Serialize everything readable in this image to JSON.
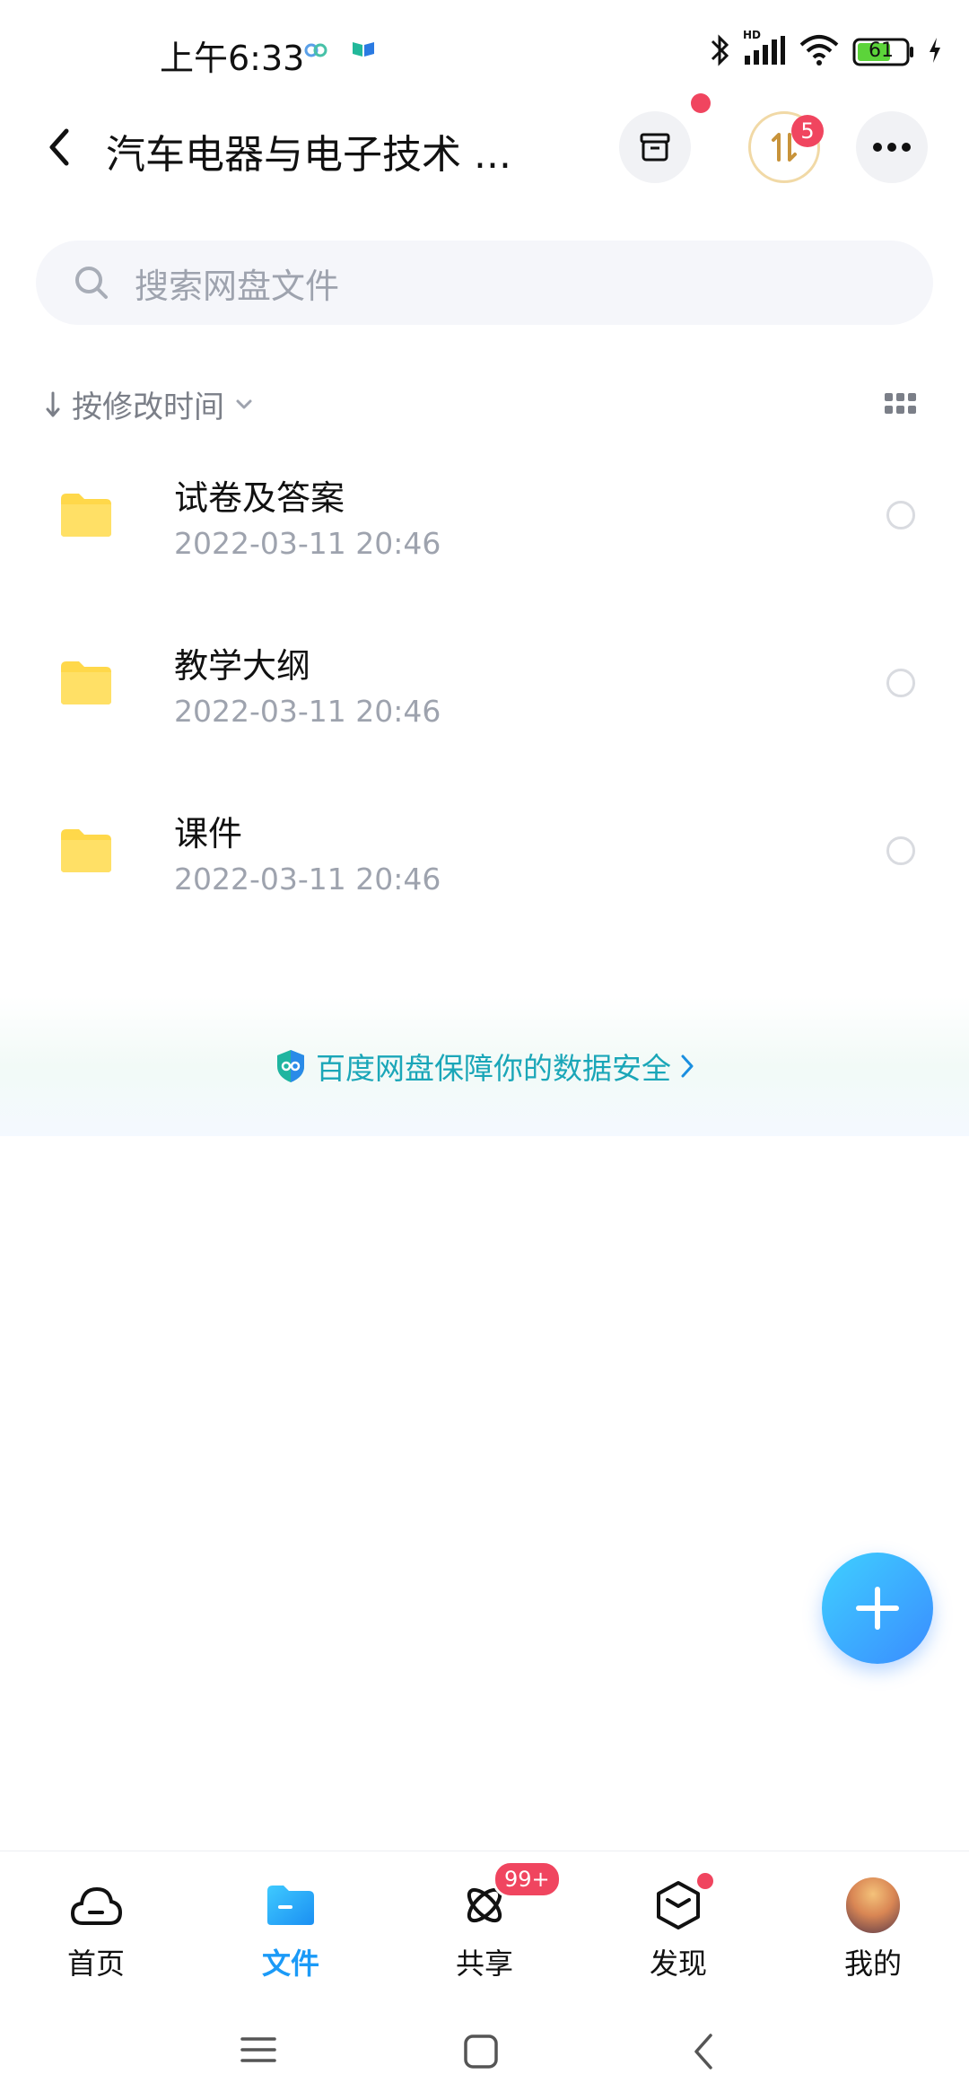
{
  "status_bar": {
    "time": "上午6:33",
    "battery": "61",
    "network_label": "HD"
  },
  "header": {
    "title": "汽车电器与电子技术 ...",
    "transfer_badge": "5"
  },
  "search": {
    "placeholder": "搜索网盘文件"
  },
  "sort": {
    "label": "按修改时间"
  },
  "files": [
    {
      "name": "试卷及答案",
      "date": "2022-03-11  20:46"
    },
    {
      "name": "教学大纲",
      "date": "2022-03-11  20:46"
    },
    {
      "name": "课件",
      "date": "2022-03-11  20:46"
    }
  ],
  "banner": {
    "text": "百度网盘保障你的数据安全"
  },
  "bottom_nav": {
    "items": [
      {
        "label": "首页",
        "icon": "cloud-home-icon"
      },
      {
        "label": "文件",
        "icon": "folder-icon",
        "active": true
      },
      {
        "label": "共享",
        "icon": "share-orbit-icon",
        "badge": "99+"
      },
      {
        "label": "发现",
        "icon": "discover-cube-icon"
      },
      {
        "label": "我的",
        "icon": "avatar"
      }
    ]
  },
  "colors": {
    "accent": "#1b9af7",
    "folder": "#ffd84a",
    "badge": "#f0455f"
  }
}
